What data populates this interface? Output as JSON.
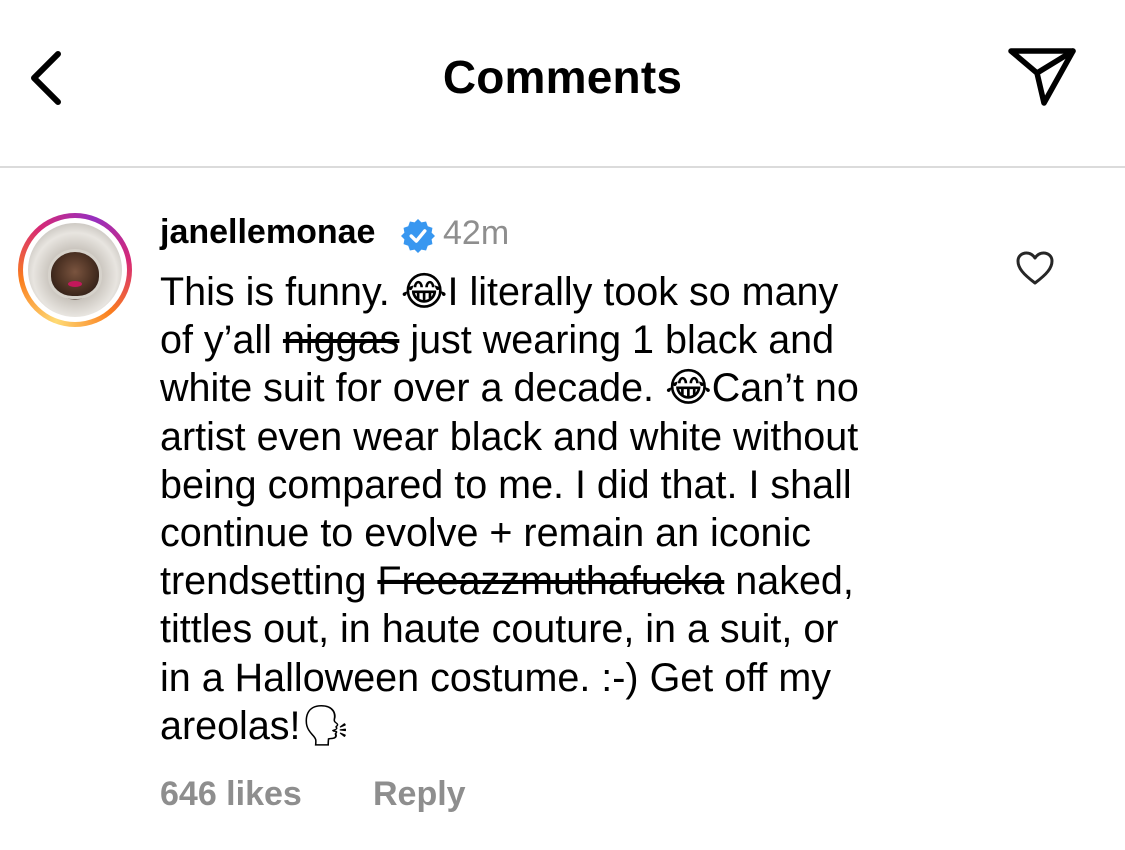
{
  "header": {
    "title": "Comments",
    "back_icon": "chevron-left-icon",
    "share_icon": "paper-plane-icon"
  },
  "comment": {
    "username": "janellemonae",
    "verified": true,
    "timestamp": "42m",
    "lines": [
      [
        "This is funny. ",
        "😂",
        "I literally took so many"
      ],
      [
        "of y’all ",
        "niggas",
        " just wearing 1 black and"
      ],
      [
        "white suit for over a decade. ",
        "😂",
        "Can’t no"
      ],
      [
        "artist even wear black and white without"
      ],
      [
        "being compared to me. I did that. I shall"
      ],
      [
        "continue to evolve + remain an iconic"
      ],
      [
        "trendsetting ",
        "Freeazzmuthafucka",
        " naked,"
      ],
      [
        "tittles out, in haute couture, in a suit, or"
      ],
      [
        "in a Halloween costume. :-) Get off my"
      ],
      [
        "areolas!",
        "🗣"
      ]
    ],
    "likes": "646 likes",
    "reply_label": "Reply"
  },
  "colors": {
    "verified_blue": "#3897f0",
    "muted_text": "#8e8e8e",
    "divider": "#dbdbdb"
  }
}
